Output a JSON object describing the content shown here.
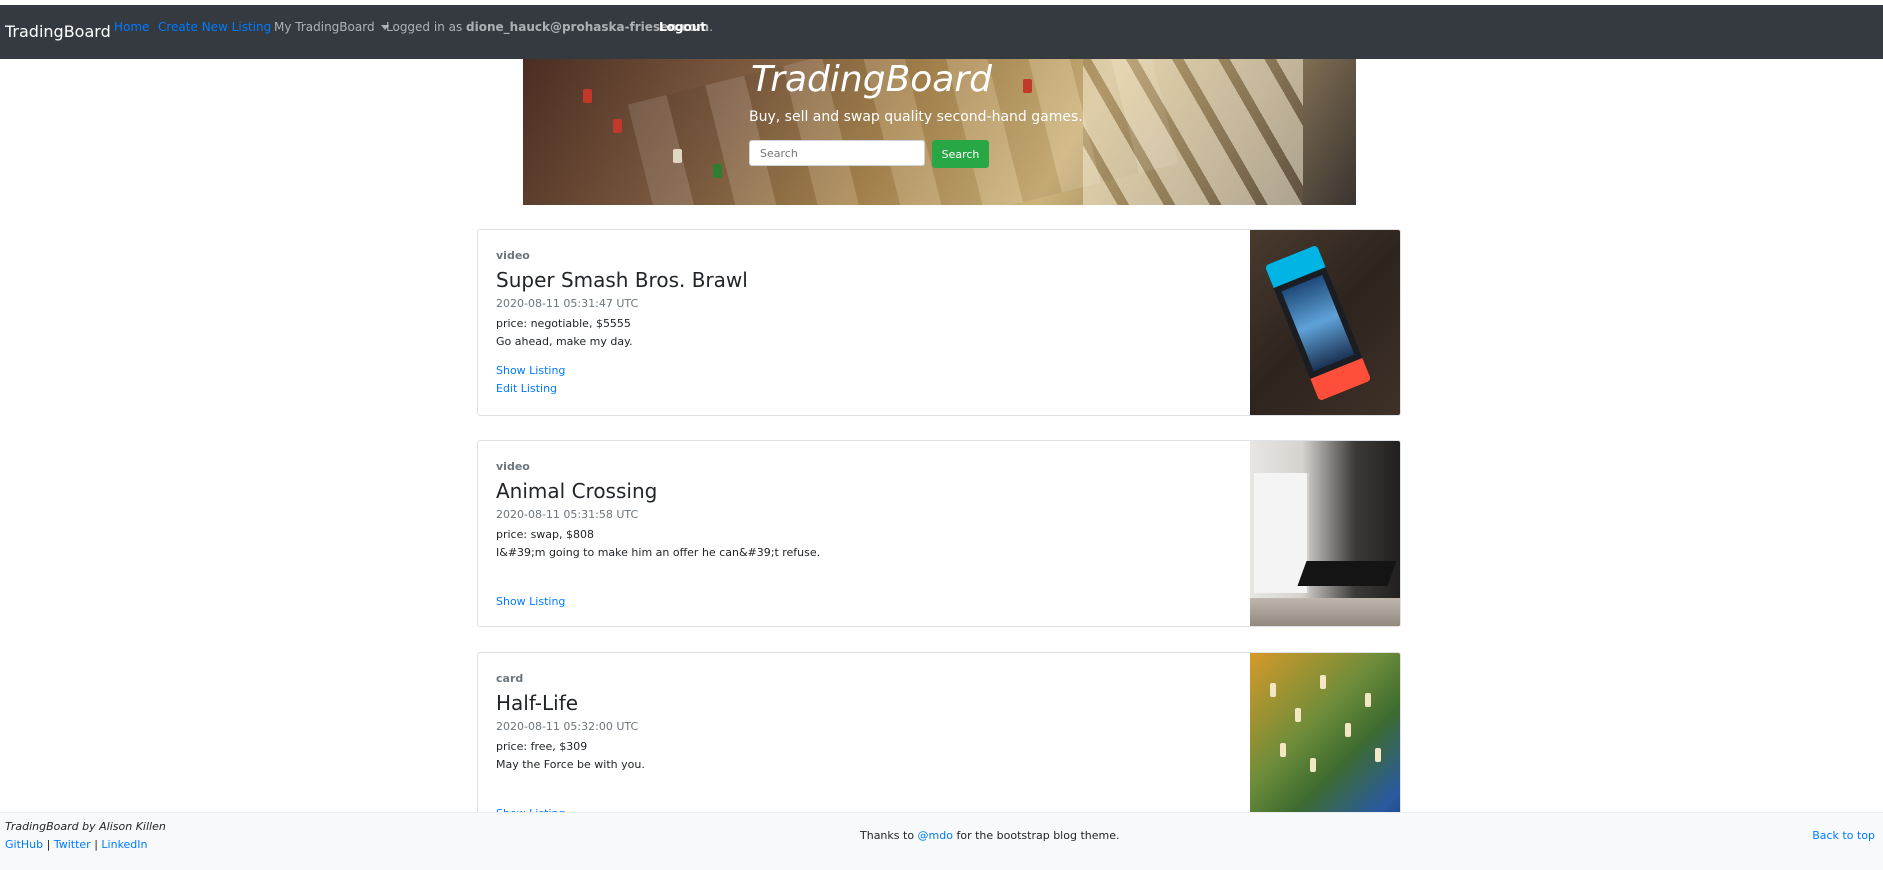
{
  "navbar": {
    "brand": "TradingBoard",
    "home": "Home",
    "create": "Create New Listing",
    "my_board": "My TradingBoard",
    "logged_prefix": "Logged in as ",
    "email": "dione_hauck@prohaska-friesen.com",
    "logged_suffix": ".",
    "logout": "Logout"
  },
  "hero": {
    "title": "TradingBoard",
    "subtitle": "Buy, sell and swap quality second-hand games.",
    "search_placeholder": "Search",
    "search_button": "Search"
  },
  "listings": [
    {
      "category": "video",
      "title": "Super Smash Bros. Brawl",
      "date": "2020-08-11 05:31:47 UTC",
      "price": "price: negotiable, $5555",
      "description": "Go ahead, make my day.",
      "show_link": "Show Listing",
      "edit_link": "Edit Listing"
    },
    {
      "category": "video",
      "title": "Animal Crossing",
      "date": "2020-08-11 05:31:58 UTC",
      "price": "price: swap, $808",
      "description": "I&#39;m going to make him an offer he can&#39;t refuse.",
      "show_link": "Show Listing"
    },
    {
      "category": "card",
      "title": "Half-Life",
      "date": "2020-08-11 05:32:00 UTC",
      "price": "price: free, $309",
      "description": "May the Force be with you.",
      "show_link": "Show Listing"
    }
  ],
  "footer": {
    "author": "TradingBoard by Alison Killen",
    "github": "GitHub",
    "twitter": "Twitter",
    "linkedin": "LinkedIn",
    "separator": " | ",
    "thanks_prefix": "Thanks to ",
    "thanks_handle": "@mdo",
    "thanks_suffix": " for the bootstrap blog theme.",
    "back_to_top": "Back to top"
  },
  "colors": {
    "navbar_bg": "#343a40",
    "link": "#007bff",
    "search_button": "#28a745",
    "footer_bg": "#f8f9fa"
  }
}
